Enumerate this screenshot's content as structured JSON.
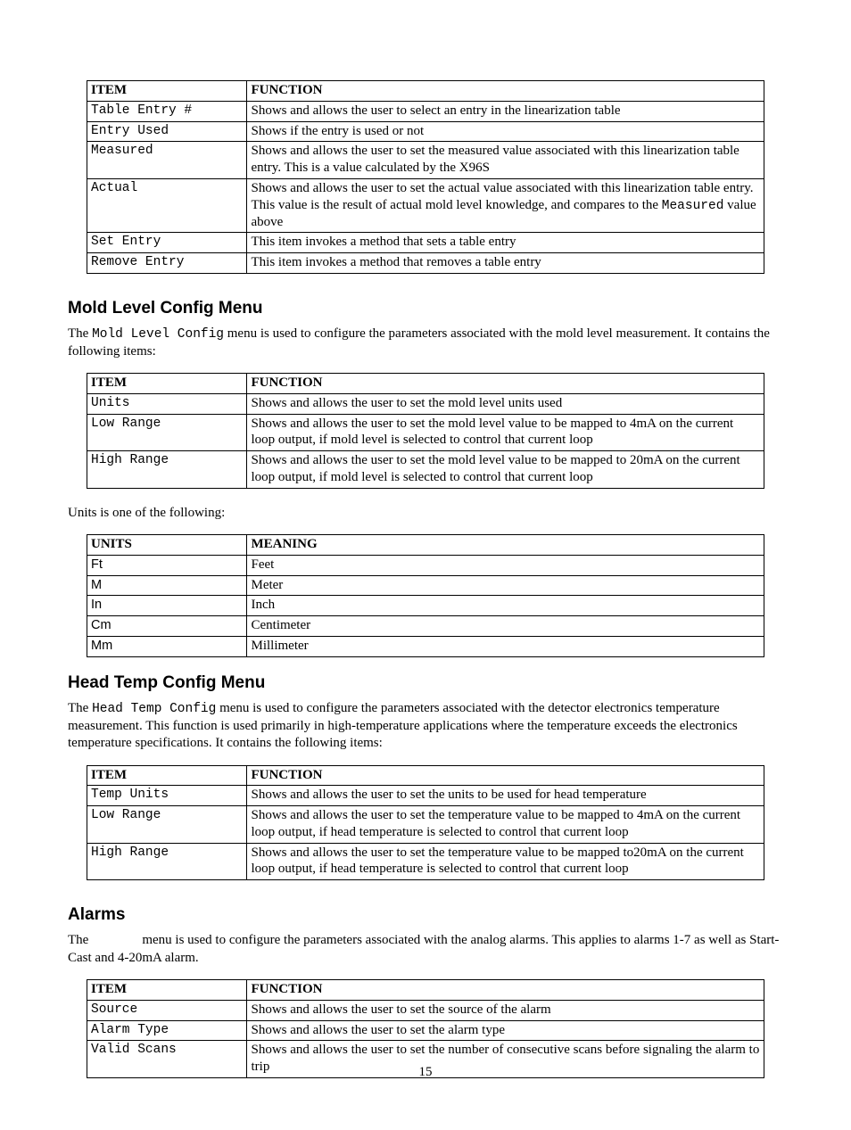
{
  "page_number": "15",
  "tables": {
    "linearization": {
      "header_item": "ITEM",
      "header_func": "FUNCTION",
      "rows": [
        {
          "item": "Table Entry #",
          "func": "Shows and allows the user to select an entry in the linearization table"
        },
        {
          "item": "Entry Used",
          "func": "Shows if the entry is used or not"
        },
        {
          "item": "Measured",
          "func_before_mono": "Shows and allows the user to set the measured value associated with this linearization table entry.  This is a value calculated by the X96S",
          "mono_insert": "",
          "func_after_mono": ""
        },
        {
          "item": "Actual",
          "func_before_mono": "Shows and allows the user to set the actual value associated with this linearization table entry.  This value is the result of actual mold level knowledge, and compares to the ",
          "mono_insert": "Measured",
          "func_after_mono": " value above"
        },
        {
          "item": "Set Entry",
          "func": "This item invokes a method that sets a table entry"
        },
        {
          "item": "Remove Entry",
          "func": "This item invokes a method that removes a table entry"
        }
      ]
    },
    "mold_config": {
      "header_item": "ITEM",
      "header_func": "FUNCTION",
      "rows": [
        {
          "item": "Units",
          "func": "Shows and allows the user to set the mold level units used"
        },
        {
          "item": "Low Range",
          "func": "Shows and allows the user to set the mold level value to be mapped to 4mA on the current loop output, if mold level is selected to control that current loop"
        },
        {
          "item": "High Range",
          "func": "Shows and allows the user to set the mold level value to be mapped to 20mA on the current loop output, if mold level is selected to control that current loop"
        }
      ]
    },
    "units": {
      "header_item": "UNITS",
      "header_func": "MEANING",
      "rows": [
        {
          "item": "Ft",
          "func": "Feet"
        },
        {
          "item": "M",
          "func": "Meter"
        },
        {
          "item": "In",
          "func": "Inch"
        },
        {
          "item": "Cm",
          "func": "Centimeter"
        },
        {
          "item": "Mm",
          "func": "Millimeter"
        }
      ]
    },
    "head_temp": {
      "header_item": "ITEM",
      "header_func": "FUNCTION",
      "rows": [
        {
          "item": "Temp Units",
          "func": "Shows and allows the user to set the units to be used for head temperature"
        },
        {
          "item": "Low Range",
          "func": "Shows and allows the user to set the temperature value to be mapped to 4mA on the current loop output, if head temperature is selected to control that current loop"
        },
        {
          "item": "High Range",
          "func": "Shows and allows the user to set the temperature value to be mapped to20mA on the current loop output, if head temperature is selected to control that current loop"
        }
      ]
    },
    "alarms": {
      "header_item": "ITEM",
      "header_func": "FUNCTION",
      "rows": [
        {
          "item": "Source",
          "func": "Shows and allows the user to set the source of the alarm"
        },
        {
          "item": "Alarm Type",
          "func": "Shows and allows the user to set the alarm type"
        },
        {
          "item": "Valid Scans",
          "func": "Shows and allows the user to set the number of consecutive scans before signaling the alarm to trip"
        }
      ]
    }
  },
  "sections": {
    "mold": {
      "heading": "Mold Level Config Menu",
      "para_pre": "The ",
      "para_mono": "Mold Level Config",
      "para_post": " menu is used to configure the parameters associated with the mold level measurement. It contains the following items:"
    },
    "units_intro": "Units is one of the following:",
    "head_temp": {
      "heading": "Head Temp Config Menu",
      "para_pre": "The ",
      "para_mono": "Head Temp Config",
      "para_post": " menu is used to configure the parameters associated with the detector electronics temperature measurement. This function is used primarily in high-temperature applications where the temperature exceeds the electronics temperature specifications.  It contains the following items:"
    },
    "alarms": {
      "heading": "Alarms",
      "para_pre": "The ",
      "para_gap": "               ",
      "para_post": "menu is used to configure the parameters associated with the analog alarms. This applies to alarms 1-7 as well as Start-Cast and 4-20mA alarm."
    }
  }
}
